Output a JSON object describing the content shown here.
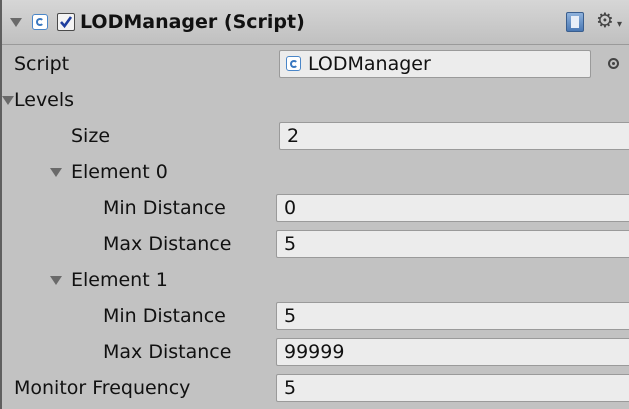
{
  "component": {
    "title": "LODManager (Script)",
    "enabled": true,
    "icons": [
      "foldout-arrow-icon",
      "csharp-script-icon",
      "enabled-checkbox",
      "help-book-icon",
      "gear-icon"
    ]
  },
  "fields": {
    "script_label": "Script",
    "script_value": "LODManager",
    "levels_label": "Levels",
    "size_label": "Size",
    "size_value": "2",
    "monitor_label": "Monitor Frequency",
    "monitor_value": "5"
  },
  "elements": [
    {
      "label": "Element 0",
      "min_label": "Min Distance",
      "min_value": "0",
      "max_label": "Max Distance",
      "max_value": "5"
    },
    {
      "label": "Element 1",
      "min_label": "Min Distance",
      "min_value": "5",
      "max_label": "Max Distance",
      "max_value": "99999"
    }
  ],
  "colors": {
    "background": "#c2c2c2",
    "field_background": "#ececec",
    "field_border": "#9a9a9a",
    "script_icon_blue": "#3a78c0"
  }
}
